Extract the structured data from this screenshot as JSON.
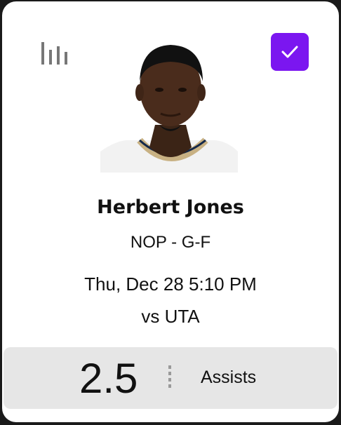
{
  "player": {
    "name": "Herbert Jones",
    "team_position": "NOP - G-F"
  },
  "game": {
    "time": "Thu, Dec 28 5:10 PM",
    "opponent": "vs UTA"
  },
  "projection": {
    "line": "2.5",
    "stat": "Assists"
  },
  "icons": {
    "stats": "bar-chart-icon",
    "selected": "checkmark-icon"
  },
  "colors": {
    "accent": "#7b16f0",
    "panel": "#e6e6e6",
    "text": "#111111"
  }
}
